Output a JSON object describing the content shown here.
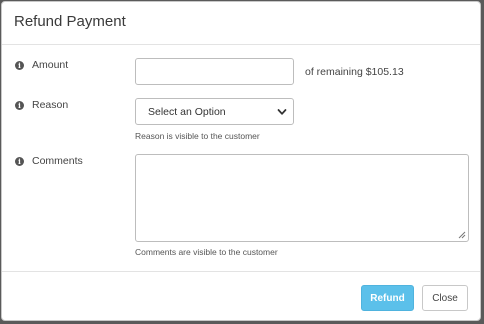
{
  "modal": {
    "title": "Refund Payment"
  },
  "form": {
    "amount": {
      "label": "Amount",
      "value": "",
      "remaining_text": "of remaining $105.13"
    },
    "reason": {
      "label": "Reason",
      "selected": "Select an Option",
      "help": "Reason is visible to the customer"
    },
    "comments": {
      "label": "Comments",
      "value": "",
      "help": "Comments are visible to the customer"
    }
  },
  "footer": {
    "refund_label": "Refund",
    "close_label": "Close"
  },
  "icons": {
    "info": "info-icon",
    "dropdown": "chevron-down-icon",
    "resize": "resize-grip-icon"
  },
  "colors": {
    "primary": "#5bc0ea",
    "overlay": "#5a5a5a"
  }
}
